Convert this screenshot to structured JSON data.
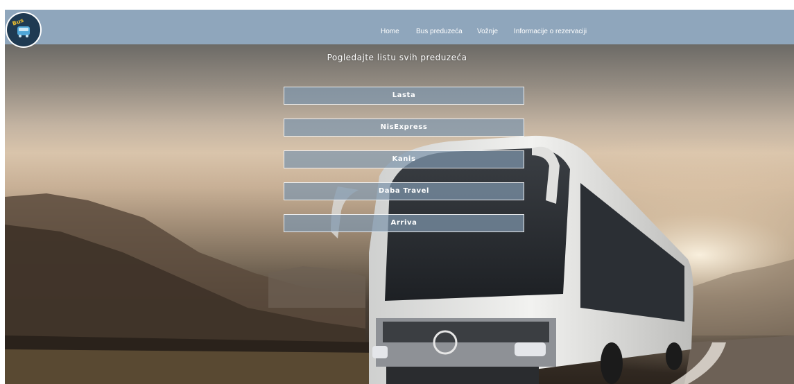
{
  "brand": {
    "logo_text": "Bus"
  },
  "nav": {
    "home": "Home",
    "companies": "Bus preduzeća",
    "rides": "Vožnje",
    "reservations": "Informacije o rezervaciji"
  },
  "main": {
    "title": "Pogledajte listu svih preduzeća",
    "companies": [
      "Lasta",
      "NisExpress",
      "Kanis",
      "Daba Travel",
      "Arriva"
    ]
  },
  "colors": {
    "navbar": "#8fa6bc",
    "button": "#7e96ac",
    "logo": "#1f3a52"
  }
}
